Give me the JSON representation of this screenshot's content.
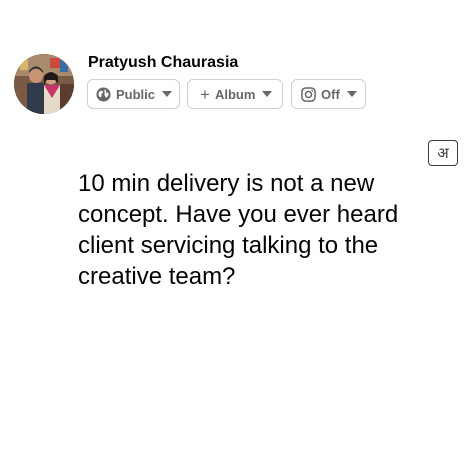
{
  "author": {
    "name": "Pratyush Chaurasia"
  },
  "audience": {
    "label": "Public",
    "icon": "globe-icon"
  },
  "album": {
    "label": "Album",
    "icon": "plus-icon"
  },
  "instagram": {
    "label": "Off",
    "icon": "instagram-icon"
  },
  "language_toggle": {
    "label": "अ"
  },
  "post": {
    "text": "10 min delivery is not a new\nconcept. Have you ever heard\nclient servicing talking to the\ncreative team?"
  },
  "colors": {
    "text": "#050505",
    "secondary_text": "#65676b",
    "pill_border": "#ced0d4",
    "background": "#ffffff"
  }
}
